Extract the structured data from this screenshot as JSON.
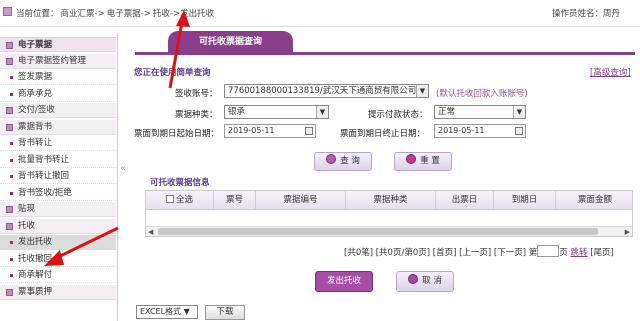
{
  "breadcrumb": {
    "prefix": "当前位置：",
    "items": [
      "商业汇票->",
      "电子票据->",
      "托收->发出托收"
    ]
  },
  "operator": {
    "label": "操作员姓名：",
    "name": "周丹"
  },
  "sidebar": {
    "items": [
      {
        "type": "head",
        "label": "电子票据"
      },
      {
        "type": "sec",
        "label": "电子票据签约管理"
      },
      {
        "type": "sub",
        "label": "签发票据"
      },
      {
        "type": "sub",
        "label": "商承承兑"
      },
      {
        "type": "sec",
        "label": "交付/签收"
      },
      {
        "type": "sec",
        "label": "票据背书"
      },
      {
        "type": "sub",
        "label": "背书转让"
      },
      {
        "type": "sub",
        "label": "批量背书转让"
      },
      {
        "type": "sub",
        "label": "背书转让撤回"
      },
      {
        "type": "sub",
        "label": "背书签收/拒绝"
      },
      {
        "type": "sec",
        "label": "贴现"
      },
      {
        "type": "sec",
        "label": "托收"
      },
      {
        "type": "sub",
        "label": "发出托收",
        "active": true
      },
      {
        "type": "sub",
        "label": "托收撤回"
      },
      {
        "type": "sub",
        "label": "商承解付"
      },
      {
        "type": "sec",
        "label": "票事质押"
      }
    ],
    "collapse_glyph": "«"
  },
  "tab": {
    "label": "可托收票据查询"
  },
  "query": {
    "title": "您正在使用简单查询",
    "advanced_link": "[高级查询]",
    "account_label": "签收账号：",
    "account_value": "77600188000133819/武汉天下通商贸有限公司",
    "default_hint": "(默认托收回款入账账号)",
    "type_label": "票据种类：",
    "type_value": "银承",
    "reminder_label": "提示付款状态：",
    "reminder_value": "正常",
    "start_label": "票面到期日起始日期：",
    "start_value": "2019-05-11",
    "end_label": "票面到期日终止日期：",
    "end_value": "2019-05-11",
    "search_btn": "查 询",
    "reset_btn": "重 置"
  },
  "table": {
    "title": "可托收票据信息",
    "select_all": "全选",
    "columns": [
      "票号",
      "票据编号",
      "票据种类",
      "出票日",
      "到期日",
      "票面金额"
    ]
  },
  "pager": {
    "info": "[共0笔]  [共0页/第0页]  [首页]  [上一页]  [下一页]  第",
    "page_unit": "页",
    "go": "跳转",
    "last": "[尾页]"
  },
  "actions": {
    "submit": "发出托收",
    "cancel": "取 消"
  },
  "export": {
    "format": "EXCEL格式",
    "download": "下载"
  },
  "colors": {
    "accent": "#8a3f8a",
    "arrow": "#e01010"
  }
}
